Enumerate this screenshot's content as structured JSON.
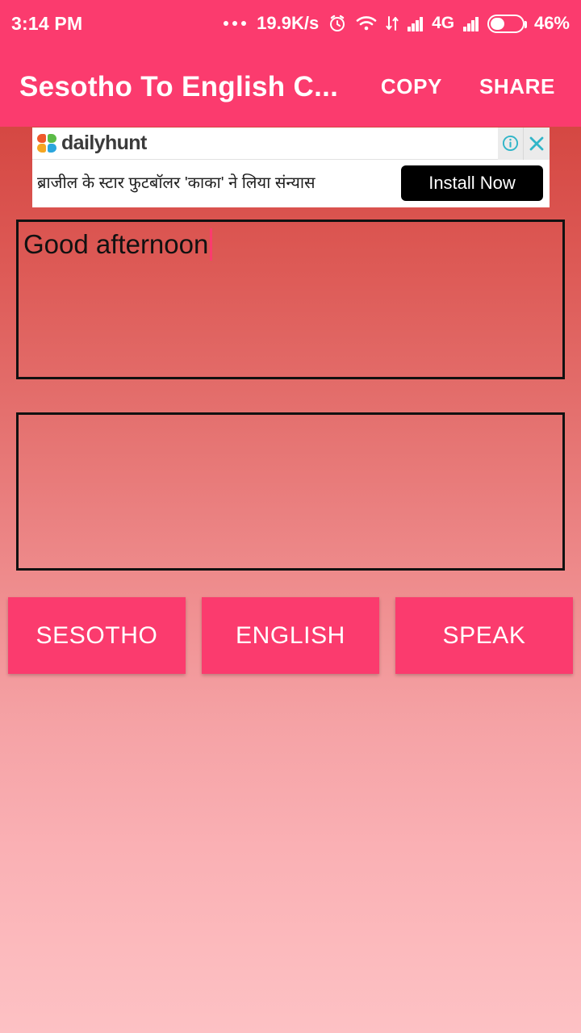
{
  "status_bar": {
    "clock": "3:14 PM",
    "overflow_dots": "…",
    "network_speed": "19.9K/s",
    "alarm_icon": "alarm-icon",
    "wifi_icon": "wifi-icon",
    "data_transfer_icon": "data-transfer-icon",
    "signal_icon_1": "signal-bars-icon",
    "network_type": "4G",
    "signal_icon_2": "signal-bars-icon",
    "battery_icon": "battery-icon",
    "battery_percent": "46%"
  },
  "app_bar": {
    "title": "Sesotho To English C...",
    "copy_label": "COPY",
    "share_label": "SHARE",
    "background_color": "#fb3b6e"
  },
  "ad": {
    "brand": "dailyhunt",
    "info_icon": "info-icon",
    "close_icon": "close-icon",
    "headline": "ब्राजील के स्टार फुटबॉलर 'काका' ने लिया संन्यास",
    "install_label": "Install Now"
  },
  "translator": {
    "source_text": "Good afternoon",
    "source_placeholder": "",
    "target_text": "",
    "target_placeholder": ""
  },
  "actions": {
    "source_language": "SESOTHO",
    "target_language": "ENGLISH",
    "speak": "SPEAK"
  },
  "theme": {
    "accent": "#fb3b6e",
    "background_top": "#c9352f",
    "background_bottom": "#fdc1c4",
    "box_border": "#111111"
  }
}
